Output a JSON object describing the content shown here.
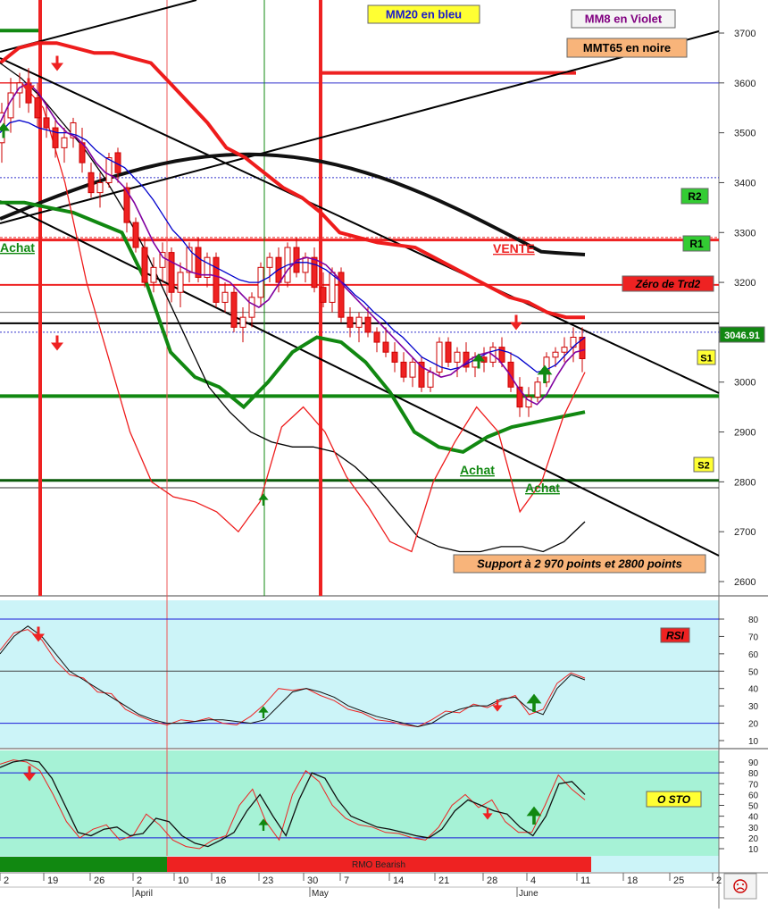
{
  "chart_data": [
    {
      "type": "candlestick",
      "panel": "price",
      "ylim": [
        2570,
        3790
      ],
      "y_ticks": [
        "2600",
        "2700",
        "2800",
        "2900",
        "3000",
        "3100",
        "3200",
        "3300",
        "3400",
        "3500",
        "3600",
        "3700"
      ],
      "grid": false,
      "labels": {
        "mm20": "MM20 en bleu",
        "mm8": "MM8 en Violet",
        "mmt65": "MMT65 en noire",
        "r2": "R2",
        "r1": "R1",
        "s1": "S1",
        "s2": "S2",
        "vente": "VENTE",
        "zero_trd2": "Zéro de Trd2",
        "last_price": "3046.91",
        "achat_left": "Achat",
        "achat_1": "Achat",
        "achat_2": "Achat",
        "support": "Support à 2 970 points et 2800 points"
      },
      "levels": {
        "r2": 3285,
        "r1": 3195,
        "zero_trd2": 3118,
        "s1": 2972,
        "s2": 2803,
        "resistance_top": 3620
      },
      "colors": {
        "mm20": "#0000cc",
        "mm8": "#8000a0",
        "mmt65": "#000000",
        "boll": "#ee1c1c",
        "green": "#118811",
        "up": "#ffffff",
        "down": "#ee2222"
      },
      "candles": [
        {
          "o": 3480,
          "h": 3560,
          "l": 3440,
          "c": 3540
        },
        {
          "o": 3530,
          "h": 3610,
          "l": 3500,
          "c": 3580
        },
        {
          "o": 3580,
          "h": 3620,
          "l": 3550,
          "c": 3600
        },
        {
          "o": 3600,
          "h": 3630,
          "l": 3540,
          "c": 3560
        },
        {
          "o": 3570,
          "h": 3600,
          "l": 3510,
          "c": 3530
        },
        {
          "o": 3530,
          "h": 3560,
          "l": 3490,
          "c": 3510
        },
        {
          "o": 3510,
          "h": 3530,
          "l": 3450,
          "c": 3470
        },
        {
          "o": 3470,
          "h": 3510,
          "l": 3440,
          "c": 3490
        },
        {
          "o": 3490,
          "h": 3530,
          "l": 3470,
          "c": 3520
        },
        {
          "o": 3480,
          "h": 3510,
          "l": 3420,
          "c": 3440
        },
        {
          "o": 3420,
          "h": 3440,
          "l": 3370,
          "c": 3380
        },
        {
          "o": 3380,
          "h": 3420,
          "l": 3350,
          "c": 3400
        },
        {
          "o": 3400,
          "h": 3460,
          "l": 3390,
          "c": 3450
        },
        {
          "o": 3460,
          "h": 3470,
          "l": 3400,
          "c": 3420
        },
        {
          "o": 3390,
          "h": 3400,
          "l": 3300,
          "c": 3320
        },
        {
          "o": 3320,
          "h": 3330,
          "l": 3260,
          "c": 3270
        },
        {
          "o": 3270,
          "h": 3290,
          "l": 3190,
          "c": 3200
        },
        {
          "o": 3200,
          "h": 3250,
          "l": 3180,
          "c": 3230
        },
        {
          "o": 3230,
          "h": 3280,
          "l": 3200,
          "c": 3260
        },
        {
          "o": 3260,
          "h": 3270,
          "l": 3160,
          "c": 3180
        },
        {
          "o": 3180,
          "h": 3240,
          "l": 3150,
          "c": 3220
        },
        {
          "o": 3220,
          "h": 3280,
          "l": 3200,
          "c": 3270
        },
        {
          "o": 3270,
          "h": 3290,
          "l": 3200,
          "c": 3210
        },
        {
          "o": 3210,
          "h": 3260,
          "l": 3190,
          "c": 3250
        },
        {
          "o": 3250,
          "h": 3260,
          "l": 3150,
          "c": 3160
        },
        {
          "o": 3160,
          "h": 3200,
          "l": 3140,
          "c": 3180
        },
        {
          "o": 3180,
          "h": 3190,
          "l": 3100,
          "c": 3110
        },
        {
          "o": 3110,
          "h": 3150,
          "l": 3080,
          "c": 3130
        },
        {
          "o": 3130,
          "h": 3180,
          "l": 3110,
          "c": 3170
        },
        {
          "o": 3170,
          "h": 3240,
          "l": 3150,
          "c": 3230
        },
        {
          "o": 3230,
          "h": 3260,
          "l": 3200,
          "c": 3250
        },
        {
          "o": 3250,
          "h": 3270,
          "l": 3180,
          "c": 3200
        },
        {
          "o": 3200,
          "h": 3280,
          "l": 3190,
          "c": 3270
        },
        {
          "o": 3270,
          "h": 3290,
          "l": 3210,
          "c": 3220
        },
        {
          "o": 3220,
          "h": 3260,
          "l": 3200,
          "c": 3250
        },
        {
          "o": 3250,
          "h": 3270,
          "l": 3180,
          "c": 3190
        },
        {
          "o": 3190,
          "h": 3220,
          "l": 3150,
          "c": 3160
        },
        {
          "o": 3160,
          "h": 3230,
          "l": 3140,
          "c": 3220
        },
        {
          "o": 3220,
          "h": 3230,
          "l": 3120,
          "c": 3130
        },
        {
          "o": 3130,
          "h": 3150,
          "l": 3090,
          "c": 3110
        },
        {
          "o": 3110,
          "h": 3140,
          "l": 3080,
          "c": 3130
        },
        {
          "o": 3130,
          "h": 3150,
          "l": 3090,
          "c": 3100
        },
        {
          "o": 3100,
          "h": 3110,
          "l": 3060,
          "c": 3080
        },
        {
          "o": 3080,
          "h": 3110,
          "l": 3050,
          "c": 3060
        },
        {
          "o": 3060,
          "h": 3080,
          "l": 3020,
          "c": 3040
        },
        {
          "o": 3040,
          "h": 3060,
          "l": 3000,
          "c": 3010
        },
        {
          "o": 3010,
          "h": 3050,
          "l": 2990,
          "c": 3040
        },
        {
          "o": 3040,
          "h": 3050,
          "l": 2980,
          "c": 2990
        },
        {
          "o": 2990,
          "h": 3030,
          "l": 2980,
          "c": 3020
        },
        {
          "o": 3020,
          "h": 3090,
          "l": 3010,
          "c": 3080
        },
        {
          "o": 3080,
          "h": 3090,
          "l": 3030,
          "c": 3040
        },
        {
          "o": 3040,
          "h": 3070,
          "l": 3010,
          "c": 3060
        },
        {
          "o": 3060,
          "h": 3080,
          "l": 3020,
          "c": 3030
        },
        {
          "o": 3030,
          "h": 3060,
          "l": 3010,
          "c": 3050
        },
        {
          "o": 3050,
          "h": 3070,
          "l": 3020,
          "c": 3040
        },
        {
          "o": 3040,
          "h": 3080,
          "l": 3030,
          "c": 3070
        },
        {
          "o": 3070,
          "h": 3090,
          "l": 3030,
          "c": 3040
        },
        {
          "o": 3040,
          "h": 3060,
          "l": 2980,
          "c": 2990
        },
        {
          "o": 2990,
          "h": 3010,
          "l": 2930,
          "c": 2950
        },
        {
          "o": 2950,
          "h": 2990,
          "l": 2930,
          "c": 2970
        },
        {
          "o": 2970,
          "h": 3010,
          "l": 2960,
          "c": 3000
        },
        {
          "o": 3000,
          "h": 3060,
          "l": 2990,
          "c": 3050
        },
        {
          "o": 3050,
          "h": 3070,
          "l": 3030,
          "c": 3060
        },
        {
          "o": 3060,
          "h": 3090,
          "l": 3040,
          "c": 3070
        },
        {
          "o": 3070,
          "h": 3110,
          "l": 3040,
          "c": 3090
        },
        {
          "o": 3090,
          "h": 3110,
          "l": 3020,
          "c": 3047
        }
      ],
      "mm20": [
        3500,
        3520,
        3525,
        3520,
        3510,
        3505,
        3500,
        3500,
        3495,
        3485,
        3465,
        3450,
        3440,
        3430,
        3410,
        3390,
        3365,
        3335,
        3305,
        3285,
        3260,
        3245,
        3235,
        3225,
        3215,
        3205,
        3200,
        3200,
        3210,
        3225,
        3235,
        3240,
        3240,
        3235,
        3225,
        3210,
        3195,
        3175,
        3160,
        3140,
        3125,
        3105,
        3090,
        3070,
        3050,
        3040,
        3030,
        3025,
        3030,
        3040,
        3050,
        3060,
        3065,
        3060,
        3050,
        3035,
        3020,
        3025,
        3035,
        3055,
        3075,
        3090
      ],
      "mm8": [
        3520,
        3560,
        3590,
        3600,
        3580,
        3550,
        3520,
        3500,
        3490,
        3470,
        3440,
        3420,
        3410,
        3390,
        3360,
        3320,
        3280,
        3250,
        3240,
        3230,
        3220,
        3215,
        3215,
        3210,
        3200,
        3180,
        3160,
        3150,
        3165,
        3195,
        3225,
        3245,
        3250,
        3245,
        3235,
        3215,
        3190,
        3170,
        3150,
        3130,
        3110,
        3090,
        3070,
        3050,
        3030,
        3020,
        3010,
        3015,
        3030,
        3045,
        3055,
        3060,
        3045,
        3020,
        2990,
        2965,
        2955,
        2975,
        3010,
        3040,
        3060,
        3065
      ],
      "mmt65": [
        3640,
        3610,
        3570,
        3520,
        3470,
        3410,
        3340,
        3260,
        3170,
        3080,
        2990,
        2940,
        2900,
        2880,
        2870,
        2870,
        2860,
        2830,
        2790,
        2740,
        2690,
        2670,
        2660,
        2660,
        2670,
        2670,
        2660,
        2680,
        2720
      ],
      "boll_upper": [
        3640,
        3670,
        3680,
        3680,
        3670,
        3660,
        3660,
        3650,
        3640,
        3600,
        3560,
        3520,
        3470,
        3450,
        3420,
        3390,
        3370,
        3340,
        3300,
        3290,
        3280,
        3275,
        3270,
        3250,
        3230,
        3210,
        3190,
        3170,
        3160,
        3140,
        3130,
        3130
      ],
      "boll_lower": [
        3600,
        3600,
        3550,
        3400,
        3200,
        3050,
        2900,
        2800,
        2770,
        2760,
        2740,
        2700,
        2760,
        2910,
        2950,
        2900,
        2810,
        2750,
        2680,
        2660,
        2800,
        2880,
        2950,
        2900,
        2740,
        2800,
        2930,
        3020
      ],
      "mmt_green": [
        3360,
        3360,
        3350,
        3340,
        3320,
        3300,
        3200,
        3060,
        3010,
        2990,
        2950,
        3000,
        3060,
        3090,
        3080,
        3040,
        2980,
        2900,
        2870,
        2860,
        2890,
        2910,
        2920,
        2930,
        2940
      ],
      "dates": [
        "2",
        "19",
        "26",
        "2",
        "10",
        "16",
        "23",
        "30",
        "7",
        "14",
        "21",
        "28",
        "4",
        "11",
        "18",
        "25",
        "2"
      ],
      "months": [
        "April",
        "May",
        "June"
      ]
    },
    {
      "type": "line",
      "panel": "rsi",
      "title_box": "RSI",
      "ylim": [
        5,
        92
      ],
      "y_ticks": [
        "10",
        "20",
        "30",
        "40",
        "50",
        "60",
        "70",
        "80"
      ],
      "levels": [
        80,
        50,
        20
      ],
      "series_black": [
        60,
        70,
        76,
        70,
        60,
        50,
        45,
        40,
        35,
        30,
        25,
        22,
        20,
        20,
        21,
        22,
        22,
        21,
        20,
        22,
        30,
        38,
        40,
        38,
        35,
        30,
        27,
        24,
        22,
        20,
        18,
        20,
        25,
        28,
        30,
        30,
        34,
        35,
        28,
        25,
        40,
        48,
        45
      ],
      "series_red": [
        62,
        72,
        74,
        68,
        56,
        48,
        46,
        38,
        37,
        28,
        24,
        21,
        19,
        22,
        21,
        23,
        20,
        19,
        24,
        31,
        40,
        39,
        40,
        36,
        33,
        28,
        26,
        22,
        21,
        19,
        18,
        22,
        27,
        26,
        31,
        29,
        33,
        36,
        25,
        28,
        43,
        49,
        46
      ]
    },
    {
      "type": "line",
      "panel": "stochastic",
      "title_box": "O STO",
      "ylim": [
        3,
        100
      ],
      "y_ticks": [
        "10",
        "20",
        "30",
        "40",
        "50",
        "60",
        "70",
        "80",
        "90"
      ],
      "levels": [
        80,
        20
      ],
      "series_black": [
        85,
        90,
        92,
        90,
        75,
        50,
        25,
        22,
        28,
        30,
        22,
        24,
        38,
        35,
        22,
        15,
        12,
        18,
        25,
        45,
        60,
        40,
        22,
        55,
        80,
        75,
        55,
        40,
        35,
        30,
        28,
        25,
        22,
        20,
        28,
        45,
        55,
        50,
        45,
        42,
        30,
        22,
        40,
        70,
        72,
        60
      ],
      "series_red": [
        88,
        92,
        90,
        82,
        60,
        35,
        20,
        28,
        32,
        18,
        22,
        42,
        32,
        18,
        12,
        10,
        18,
        22,
        50,
        65,
        35,
        18,
        60,
        82,
        72,
        50,
        38,
        32,
        30,
        25,
        24,
        20,
        18,
        30,
        50,
        60,
        48,
        55,
        35,
        25,
        25,
        50,
        78,
        65,
        55
      ]
    }
  ],
  "rmo_label": "RMO Bearish"
}
